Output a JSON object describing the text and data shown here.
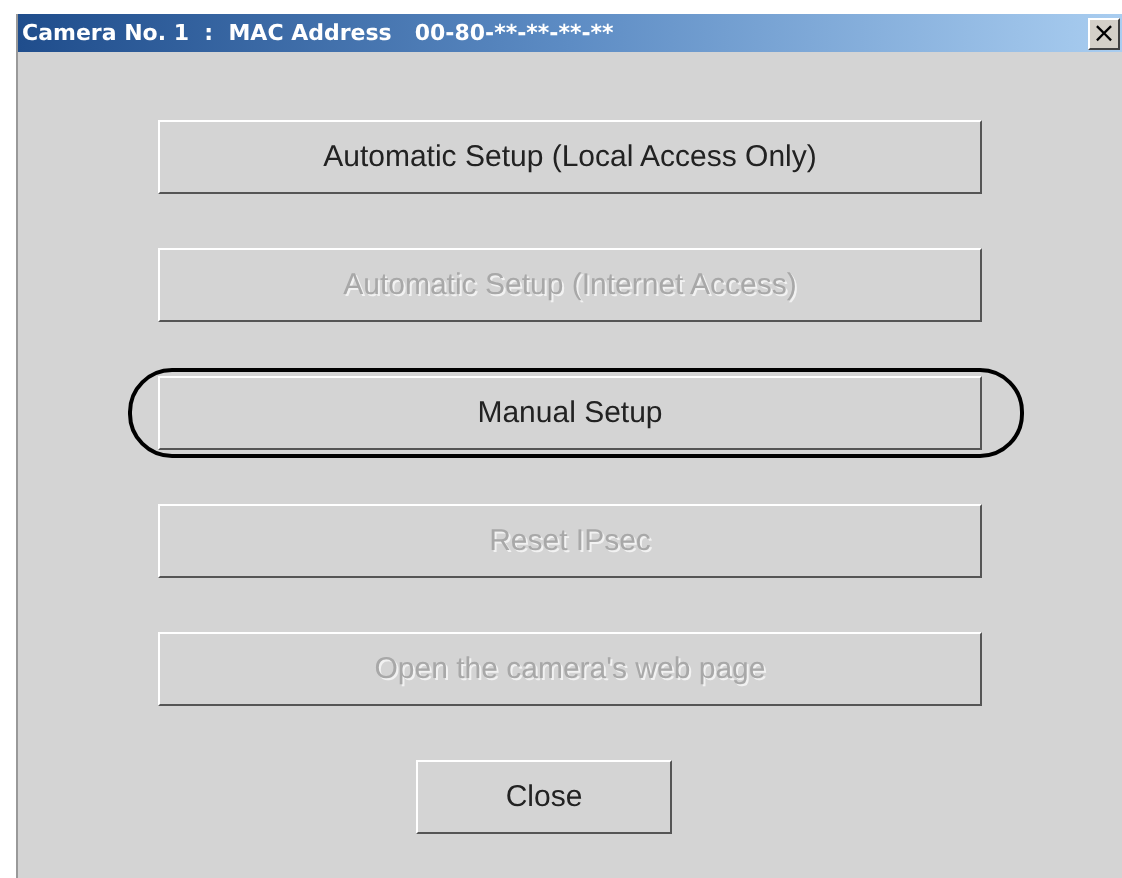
{
  "window": {
    "title": "Camera No. 1  :  MAC Address   00-80-**-**-**-**",
    "close": "×"
  },
  "buttons": [
    {
      "label": "Automatic Setup (Local Access Only)",
      "disabled": false,
      "highlighted": false
    },
    {
      "label": "Automatic Setup (Internet Access)",
      "disabled": true,
      "highlighted": false
    },
    {
      "label": "Manual Setup",
      "disabled": false,
      "highlighted": true
    },
    {
      "label": "Reset  IPsec",
      "disabled": true,
      "highlighted": false
    },
    {
      "label": "Open the camera's web page",
      "disabled": true,
      "highlighted": false
    }
  ],
  "close_button": {
    "label": "Close"
  }
}
